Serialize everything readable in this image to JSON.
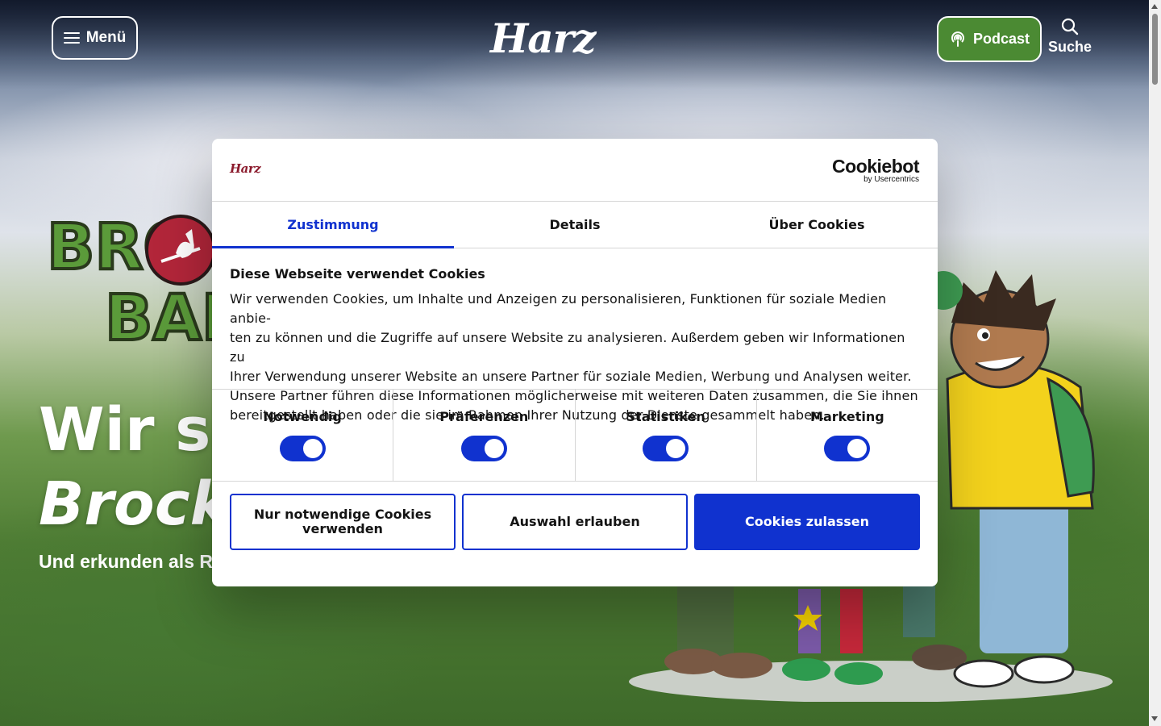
{
  "header": {
    "menu_label": "Menü",
    "logo_text": "Harz",
    "podcast_label": "Podcast",
    "search_label": "Suche"
  },
  "hero": {
    "brand_line1": "BRO",
    "brand_line2": "BAN",
    "title_line1": "Wir si",
    "title_line2": "Brock",
    "subtitle": "Und erkunden als R"
  },
  "consent": {
    "logo_text": "Harz",
    "provider_name": "Cookiebot",
    "provider_sub": "by Usercentrics",
    "tabs": [
      {
        "label": "Zustimmung",
        "active": true
      },
      {
        "label": "Details",
        "active": false
      },
      {
        "label": "Über Cookies",
        "active": false
      }
    ],
    "heading": "Diese Webseite verwendet Cookies",
    "text_lines": [
      "Wir verwenden Cookies, um Inhalte und Anzeigen zu personalisieren, Funktionen für soziale Medien anbie-",
      "ten zu können und die Zugriffe auf unsere Website zu analysieren. Außerdem geben wir Informationen zu",
      "Ihrer Verwendung unserer Website an unsere Partner für soziale Medien, Werbung und Analysen weiter.",
      "Unsere Partner führen diese Informationen möglicherweise mit weiteren Daten zusammen, die Sie ihnen",
      "bereitgestellt haben oder die sie im Rahmen Ihrer Nutzung der Dienste gesammelt haben."
    ],
    "categories": [
      {
        "label": "Notwendig",
        "enabled": true
      },
      {
        "label": "Präferenzen",
        "enabled": true
      },
      {
        "label": "Statistiken",
        "enabled": true
      },
      {
        "label": "Marketing",
        "enabled": true
      }
    ],
    "buttons": {
      "necessary_only_line1": "Nur notwendige Cookies",
      "necessary_only_line2": "verwenden",
      "allow_selection": "Auswahl erlauben",
      "allow_all": "Cookies zulassen"
    }
  },
  "colors": {
    "accent": "#1032cf",
    "podcast_green": "#4b8a33",
    "brand_red": "#8b1a2c"
  }
}
